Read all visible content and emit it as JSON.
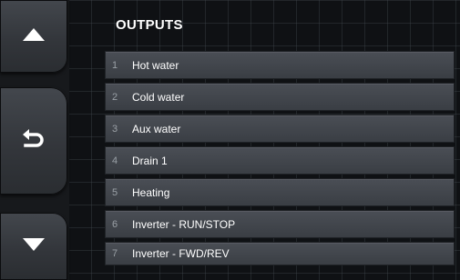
{
  "header": {
    "title": "OUTPUTS"
  },
  "nav": {
    "up_icon": "chevron-up-icon",
    "back_icon": "back-arrow-icon",
    "down_icon": "chevron-down-icon"
  },
  "outputs": [
    {
      "num": "1",
      "label": "Hot water"
    },
    {
      "num": "2",
      "label": "Cold water"
    },
    {
      "num": "3",
      "label": "Aux water"
    },
    {
      "num": "4",
      "label": "Drain 1"
    },
    {
      "num": "5",
      "label": "Heating"
    },
    {
      "num": "6",
      "label": "Inverter - RUN/STOP"
    },
    {
      "num": "7",
      "label": "Inverter - FWD/REV"
    }
  ]
}
